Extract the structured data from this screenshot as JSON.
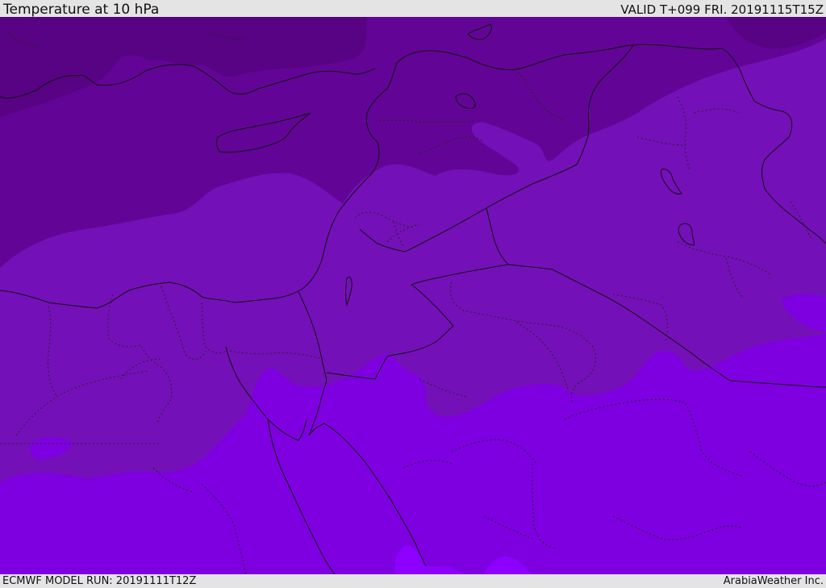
{
  "header": {
    "title": "Temperature at 10 hPa",
    "valid_time": "VALID T+099 FRI. 20191115T15Z"
  },
  "footer": {
    "model_run": "ECMWF MODEL RUN: 20191111T12Z",
    "credit": "ArabiaWeather Inc."
  },
  "map": {
    "field": "Temperature at 10 hPa",
    "palette": {
      "darkest": "#570383",
      "dark": "#620596",
      "medium": "#7410b8",
      "light": "#7e00e0",
      "lightest": "#8d00ff",
      "boundary_line": "#111111"
    }
  }
}
